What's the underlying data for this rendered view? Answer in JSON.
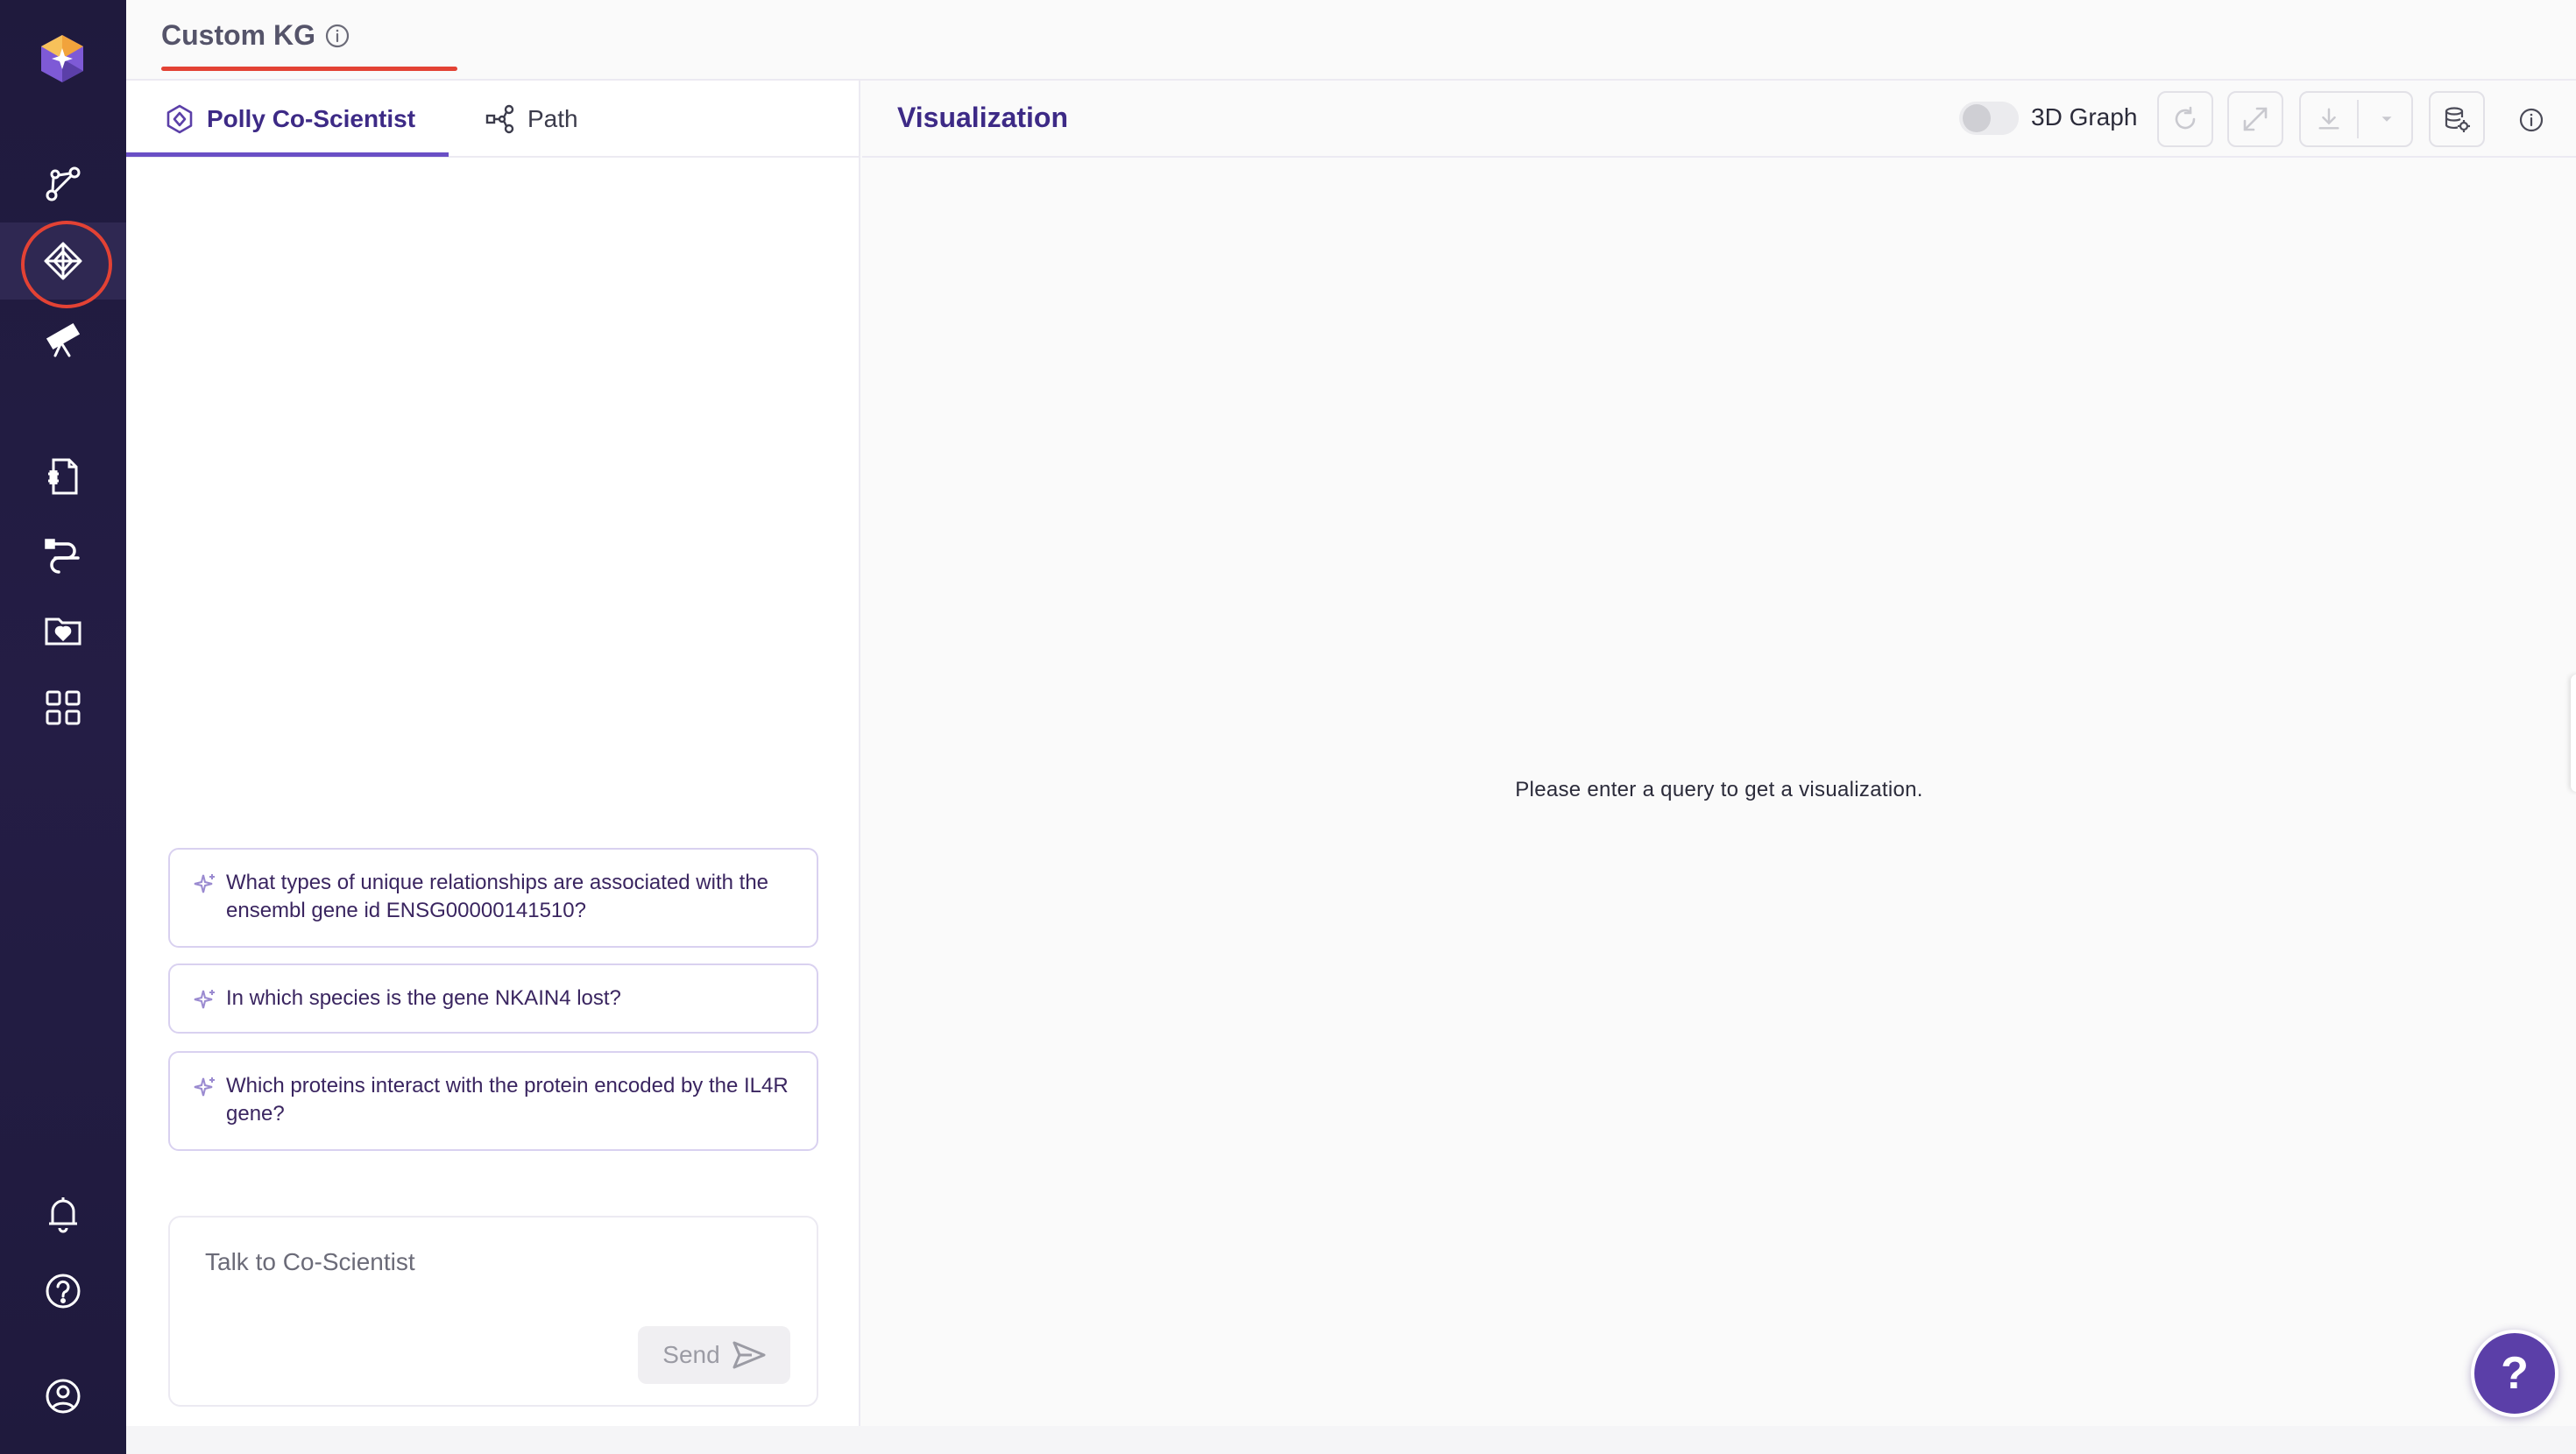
{
  "header": {
    "title": "Custom KG"
  },
  "left_panel": {
    "tabs": [
      {
        "label": "Polly Co-Scientist",
        "active": true
      },
      {
        "label": "Path",
        "active": false
      }
    ],
    "suggestions": [
      "What types of unique relationships are associated with the ensembl gene id ENSG00000141510?",
      "In which species is the gene NKAIN4 lost?",
      "Which proteins interact with the protein encoded by the IL4R gene?"
    ],
    "chat": {
      "placeholder": "Talk to Co-Scientist",
      "value": "",
      "send_label": "Send"
    }
  },
  "visualization": {
    "title": "Visualization",
    "toggle_label": "3D Graph",
    "toggle_on": false,
    "empty_message": "Please enter a query to get a visualization."
  },
  "help": {
    "label": "?"
  },
  "colors": {
    "rail_background": "#1f1a3d",
    "accent_purple": "#3d2a86",
    "highlight_red": "#e34234",
    "fab_purple": "#5b3fa8"
  },
  "icons": {
    "rail_top": [
      "graph-pin-icon",
      "knowledge-graph-icon",
      "telescope-icon"
    ],
    "rail_middle": [
      "document-grid-icon",
      "pipeline-icon",
      "favorites-folder-icon",
      "apps-grid-icon"
    ],
    "rail_bottom": [
      "bell-icon",
      "help-circle-icon",
      "user-account-icon"
    ],
    "viz_tools": [
      "refresh-icon",
      "expand-icon",
      "download-icon",
      "chevron-down-icon",
      "database-settings-icon",
      "info-icon"
    ]
  }
}
